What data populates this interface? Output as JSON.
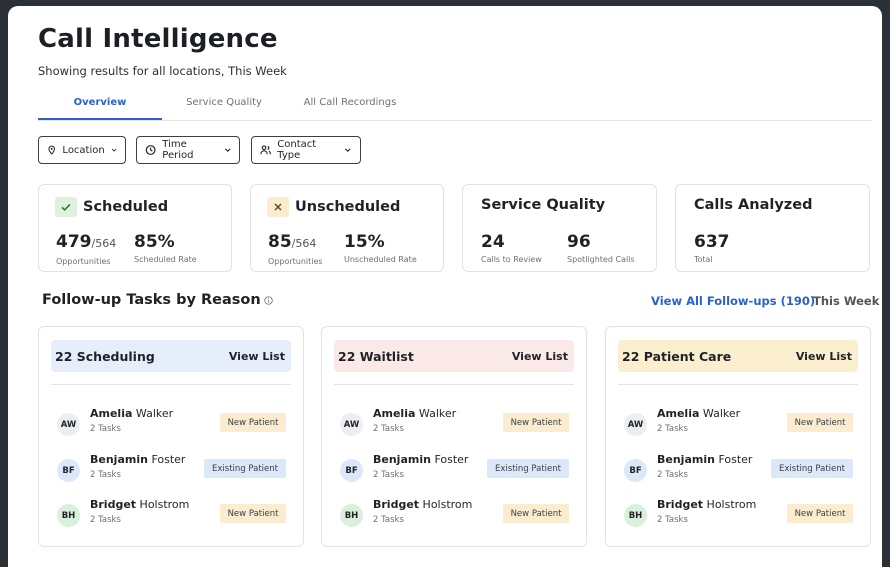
{
  "page": {
    "title": "Call Intelligence",
    "subtitle": "Showing results for all locations, This Week"
  },
  "tabs": [
    {
      "label": "Overview",
      "active": true
    },
    {
      "label": "Service Quality",
      "active": false
    },
    {
      "label": "All Call Recordings",
      "active": false
    }
  ],
  "filters": [
    {
      "label": "Location",
      "icon": "map-pin-icon"
    },
    {
      "label": "Time Period",
      "icon": "clock-icon"
    },
    {
      "label": "Contact Type",
      "icon": "contacts-icon"
    }
  ],
  "stats": {
    "scheduled": {
      "title": "Scheduled",
      "count": "479",
      "total": "/564",
      "count_label": "Opportunities",
      "rate": "85%",
      "rate_label": "Scheduled Rate"
    },
    "unscheduled": {
      "title": "Unscheduled",
      "count": "85",
      "total": "/564",
      "count_label": "Opportunities",
      "rate": "15%",
      "rate_label": "Unscheduled Rate"
    },
    "service_quality": {
      "title": "Service Quality",
      "review": "24",
      "review_label": "Calls to Review",
      "spotlight": "96",
      "spotlight_label": "Spotlighted Calls"
    },
    "calls_analyzed": {
      "title": "Calls Analyzed",
      "total": "637",
      "total_label": "Total"
    }
  },
  "followups": {
    "title": "Follow-up Tasks by Reason",
    "view_all": "View All Follow-ups (190)",
    "period": "This Week",
    "view_list": "View List",
    "cards": [
      {
        "count": "22",
        "reason": "Scheduling",
        "color": "#e6eefb",
        "rows": [
          {
            "initials": "AW",
            "first": "Amelia",
            "last": "Walker",
            "tasks": "2 Tasks",
            "tag": "New Patient",
            "avatar_color": "#eceef1"
          },
          {
            "initials": "BF",
            "first": "Benjamin",
            "last": "Foster",
            "tasks": "2 Tasks",
            "tag": "Existing Patient",
            "avatar_color": "#dbe8f9"
          },
          {
            "initials": "BH",
            "first": "Bridget",
            "last": "Holstrom",
            "tasks": "2 Tasks",
            "tag": "New Patient",
            "avatar_color": "#d9f0da"
          }
        ]
      },
      {
        "count": "22",
        "reason": "Waitlist",
        "color": "#fbe9e7",
        "rows": [
          {
            "initials": "AW",
            "first": "Amelia",
            "last": "Walker",
            "tasks": "2 Tasks",
            "tag": "New Patient",
            "avatar_color": "#eceef1"
          },
          {
            "initials": "BF",
            "first": "Benjamin",
            "last": "Foster",
            "tasks": "2 Tasks",
            "tag": "Existing Patient",
            "avatar_color": "#dbe8f9"
          },
          {
            "initials": "BH",
            "first": "Bridget",
            "last": "Holstrom",
            "tasks": "2 Tasks",
            "tag": "New Patient",
            "avatar_color": "#d9f0da"
          }
        ]
      },
      {
        "count": "22",
        "reason": "Patient Care",
        "color": "#fcefd0",
        "rows": [
          {
            "initials": "AW",
            "first": "Amelia",
            "last": "Walker",
            "tasks": "2 Tasks",
            "tag": "New Patient",
            "avatar_color": "#eceef1"
          },
          {
            "initials": "BF",
            "first": "Benjamin",
            "last": "Foster",
            "tasks": "2 Tasks",
            "tag": "Existing Patient",
            "avatar_color": "#dbe8f9"
          },
          {
            "initials": "BH",
            "first": "Bridget",
            "last": "Holstrom",
            "tasks": "2 Tasks",
            "tag": "New Patient",
            "avatar_color": "#d9f0da"
          }
        ]
      }
    ]
  },
  "colors": {
    "accent": "#2a62c9",
    "scheduled_badge": "#dff1dc",
    "unscheduled_badge": "#fbecd0",
    "new_patient_tag": "#fbecd0",
    "existing_patient_tag": "#dbe8f9"
  }
}
